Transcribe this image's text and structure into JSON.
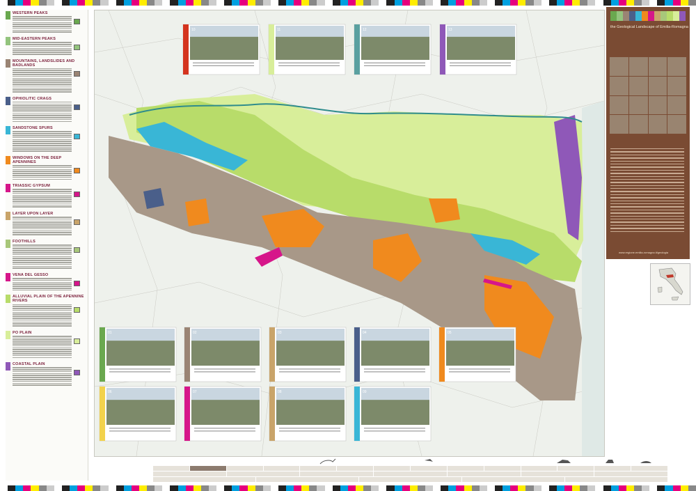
{
  "colors": {
    "panel_brown": "#7a4b33",
    "legend_title": "#7a1e3a",
    "sea": "#dfe9e6",
    "alluvial": "#d8ee9a",
    "po_plain": "#b8dc6a",
    "deep_windows": "#f08a1e",
    "mountains_badlands": "#9a8474",
    "ophiolitic": "#4a5f8a",
    "sandstone": "#39b6d6",
    "gypsum": "#d6168a",
    "coastal": "#8f58b8",
    "river": "#2f8c8c"
  },
  "legend": {
    "sections": [
      {
        "title": "Western Peaks",
        "color": "#6aa84f",
        "lines": 9
      },
      {
        "title": "Mid-Eastern Peaks",
        "color": "#93c47d",
        "lines": 7
      },
      {
        "title": "Mountains, Landslides and Badlands",
        "color": "#9a8474",
        "lines": 13
      },
      {
        "title": "Ophiolitic Crags",
        "color": "#4a5f8a",
        "lines": 11
      },
      {
        "title": "Sandstone Spurs",
        "color": "#39b6d6",
        "lines": 11
      },
      {
        "title": "Windows on the Deep Apennines",
        "color": "#f08a1e",
        "lines": 8
      },
      {
        "title": "Triassic Gypsum",
        "color": "#d6168a",
        "lines": 10
      },
      {
        "title": "Layer upon Layer",
        "color": "#c9a46a",
        "lines": 10
      },
      {
        "title": "Foothills",
        "color": "#a8c77a",
        "lines": 13
      },
      {
        "title": "Vena del Gesso",
        "color": "#d6168a",
        "lines": 7
      },
      {
        "title": "Alluvial Plain of the Apennine Rivers",
        "color": "#b8dc6a",
        "lines": 12
      },
      {
        "title": "Po Plain",
        "color": "#d8ee9a",
        "lines": 12
      },
      {
        "title": "Coastal Plain",
        "color": "#8f58b8",
        "lines": 10
      }
    ]
  },
  "panel": {
    "title": "the Geological Landscape of Emilia-Romagna",
    "url": "www.regione.emilia-romagna.it/geologia"
  },
  "photos_top": [
    {
      "num": "10",
      "color": "#d4341e"
    },
    {
      "num": "11",
      "color": "#d8ee9a"
    },
    {
      "num": "12",
      "color": "#5aa0a0"
    },
    {
      "num": "13",
      "color": "#8f58b8"
    }
  ],
  "photos_bottom": [
    {
      "num": "01",
      "color": "#6aa84f"
    },
    {
      "num": "02",
      "color": "#9a8474"
    },
    {
      "num": "03",
      "color": "#c9a46a"
    },
    {
      "num": "04",
      "color": "#4a5f8a"
    },
    {
      "num": "05",
      "color": "#f08a1e"
    },
    {
      "num": "06",
      "color": "#f2d24c"
    },
    {
      "num": "07",
      "color": "#d6168a"
    },
    {
      "num": "08",
      "color": "#c9a46a"
    },
    {
      "num": "09",
      "color": "#39b6d6"
    }
  ]
}
